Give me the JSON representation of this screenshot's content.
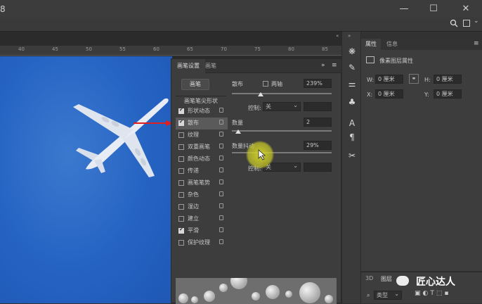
{
  "titlebar": {
    "left_glyph": "8",
    "window_controls": [
      "—",
      "☐",
      "✕"
    ]
  },
  "optionsbar": {
    "right_icons": [
      "search-icon",
      "panel-layout-icon",
      "chevron-down-icon"
    ]
  },
  "ruler": {
    "ticks": [
      "40",
      "45",
      "50",
      "55",
      "60",
      "65",
      "70",
      "75",
      "80",
      "85"
    ]
  },
  "brush_panel": {
    "tabs": [
      "画笔设置",
      "画笔"
    ],
    "brush_button": "画笔",
    "tip_shape_header": "画笔笔尖形状",
    "options": [
      {
        "label": "形状动态",
        "checked": true,
        "selected": false
      },
      {
        "label": "散布",
        "checked": true,
        "selected": true
      },
      {
        "label": "纹理",
        "checked": false,
        "selected": false
      },
      {
        "label": "双重画笔",
        "checked": false,
        "selected": false
      },
      {
        "label": "颜色动态",
        "checked": false,
        "selected": false
      },
      {
        "label": "传递",
        "checked": false,
        "selected": false
      },
      {
        "label": "画笔笔势",
        "checked": false,
        "selected": false
      },
      {
        "label": "杂色",
        "checked": false,
        "selected": false
      },
      {
        "label": "湿边",
        "checked": false,
        "selected": false
      },
      {
        "label": "建立",
        "checked": false,
        "selected": false
      },
      {
        "label": "平滑",
        "checked": true,
        "selected": false
      },
      {
        "label": "保护纹理",
        "checked": false,
        "selected": false
      }
    ],
    "scatter": {
      "label": "散布",
      "both_axes_label": "两轴",
      "both_axes_checked": false,
      "value": "239%",
      "slider_level": 0.29
    },
    "control1": {
      "label": "控制:",
      "value": "关"
    },
    "count": {
      "label": "数量",
      "value": "2",
      "slider_level": 0.06
    },
    "count_jitter": {
      "label": "数量抖动",
      "value": "29%",
      "slider_level": 0.29
    },
    "control2": {
      "label": "控制:",
      "value": "关"
    }
  },
  "toolstrip": {
    "icons": [
      "compass-icon",
      "brush-settings-icon",
      "sliders-icon",
      "clone-source-icon",
      "character-icon",
      "paragraph-icon",
      "tools-icon"
    ]
  },
  "properties_panel": {
    "tabs": [
      "属性",
      "信息"
    ],
    "layer_title": "像素图层属性",
    "fields": {
      "w_label": "W:",
      "w_value": "0 厘米",
      "h_label": "H:",
      "h_value": "0 厘米",
      "x_label": "X:",
      "x_value": "0 厘米",
      "y_label": "Y:",
      "y_value": "0 厘米"
    }
  },
  "layers_panel": {
    "tabs": [
      "3D",
      "图层"
    ],
    "filter_label": "类型"
  },
  "watermark": {
    "text": "匠心达人"
  },
  "colors": {
    "panel_bg": "#3d3d3d",
    "canvas_blue": "#2563c3",
    "arrow_red": "#e02020",
    "cursor_yellow": "#d6d630"
  }
}
